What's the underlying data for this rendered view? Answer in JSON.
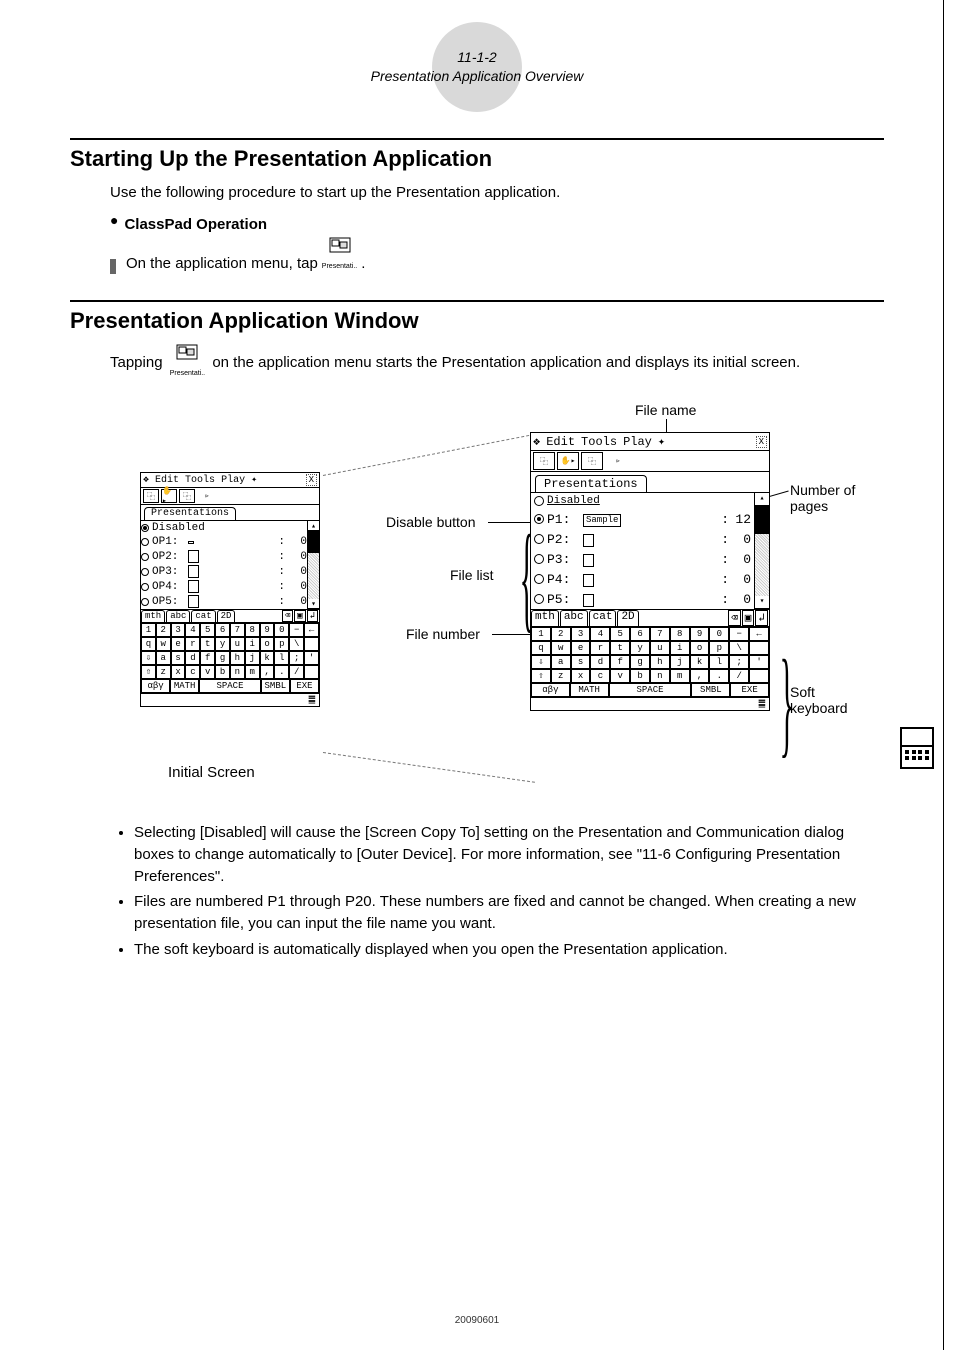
{
  "header": {
    "page_ref": "11-1-2",
    "chapter": "Presentation Application Overview"
  },
  "section1": {
    "title": "Starting Up the Presentation Application",
    "intro": "Use the following procedure to start up the Presentation application.",
    "op_heading": "ClassPad Operation",
    "op_step": "On the application menu, tap",
    "icon_label": "Presentati.."
  },
  "section2": {
    "title": "Presentation Application Window",
    "intro_a": "Tapping",
    "intro_b": "on the application menu starts the Presentation application and displays its initial screen.",
    "icon_label": "Presentati.."
  },
  "labels": {
    "file_name": "File name",
    "disable_button": "Disable button",
    "file_list": "File list",
    "file_number": "File number",
    "number_of_pages": "Number of pages",
    "soft_keyboard": "Soft keyboard",
    "initial_screen": "Initial Screen"
  },
  "screen": {
    "menus": [
      "Edit",
      "Tools",
      "Play"
    ],
    "tab": "Presentations",
    "disabled": "Disabled",
    "left_rows": [
      {
        "id": "P1",
        "file": "",
        "pages": "0"
      },
      {
        "id": "P2",
        "file": "▯",
        "pages": "0"
      },
      {
        "id": "P3",
        "file": "▯",
        "pages": "0"
      },
      {
        "id": "P4",
        "file": "▯",
        "pages": "0"
      },
      {
        "id": "P5",
        "file": "▯",
        "pages": "0"
      }
    ],
    "right_rows": [
      {
        "id": "P1",
        "file": "Sample",
        "pages": "12"
      },
      {
        "id": "P2",
        "file": "▯",
        "pages": "0"
      },
      {
        "id": "P3",
        "file": "▯",
        "pages": "0"
      },
      {
        "id": "P4",
        "file": "▯",
        "pages": "0"
      },
      {
        "id": "P5",
        "file": "▯",
        "pages": "0"
      }
    ],
    "kbd_tabs": [
      "mth",
      "abc",
      "cat",
      "2D"
    ],
    "kbd_row1": [
      "1",
      "2",
      "3",
      "4",
      "5",
      "6",
      "7",
      "8",
      "9",
      "0",
      "−",
      "←"
    ],
    "kbd_row2": [
      "q",
      "w",
      "e",
      "r",
      "t",
      "y",
      "u",
      "i",
      "o",
      "p",
      "\\",
      " "
    ],
    "kbd_row3": [
      "⇩",
      "a",
      "s",
      "d",
      "f",
      "g",
      "h",
      "j",
      "k",
      "l",
      ";",
      "'"
    ],
    "kbd_row4": [
      "⇧",
      "z",
      "x",
      "c",
      "v",
      "b",
      "n",
      "m",
      ",",
      ".",
      "/",
      " "
    ],
    "kbd_row5": [
      "αβγ",
      "MATH",
      "SPACE",
      "SMBL",
      "EXE"
    ],
    "status": "䷀"
  },
  "notes": [
    "Selecting [Disabled] will cause the [Screen Copy To] setting on the Presentation and Communication dialog boxes to change automatically to [Outer Device]. For more information, see \"11-6 Configuring Presentation Preferences\".",
    "Files are numbered P1 through P20. These numbers are fixed and cannot be changed. When creating a new presentation file, you can input the file name you want.",
    "The soft keyboard is automatically displayed when you open the Presentation application."
  ],
  "footer": "20090601"
}
